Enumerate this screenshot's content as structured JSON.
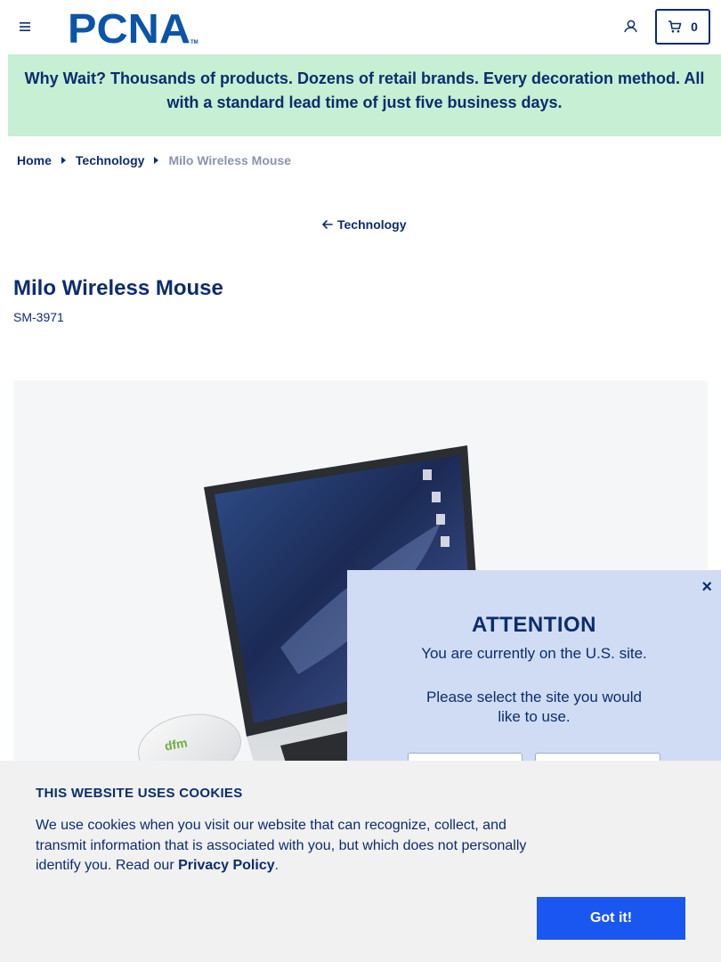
{
  "header": {
    "logo_text": "PCNA",
    "logo_mark": "TM",
    "cart_count": "0"
  },
  "promo": {
    "text": "Why Wait? Thousands of products. Dozens of retail brands. Every decoration method. All with a standard lead time of just five business days."
  },
  "breadcrumb": {
    "items": [
      "Home",
      "Technology"
    ],
    "current": "Milo Wireless Mouse"
  },
  "back_link": {
    "label": "Technology"
  },
  "product": {
    "title": "Milo Wireless Mouse",
    "sku": "SM-3971",
    "imprint_logo": "dfm"
  },
  "attention_modal": {
    "title": "ATTENTION",
    "text": "You are currently on the U.S. site.",
    "prompt": "Please select the site you would like to use.",
    "close": "×"
  },
  "cookie_banner": {
    "title": "THIS WEBSITE USES COOKIES",
    "text": "We use cookies when you visit our website that can recognize, collect, and transmit information that is associated with you, but which does not personally identify you. Read our ",
    "link": "Privacy Policy",
    "after": ".",
    "button": "Got it!"
  },
  "colors": {
    "navy": "#0b2d6e",
    "logo_blue": "#0a55a8",
    "promo_bg": "#c6efd4",
    "modal_bg": "#cfdcf3",
    "cookie_bg": "#f1f1f1",
    "button_blue": "#1a57f0"
  },
  "icons": [
    "menu-icon",
    "user-icon",
    "cart-icon",
    "caret-right-icon",
    "arrow-left-icon",
    "close-icon"
  ]
}
